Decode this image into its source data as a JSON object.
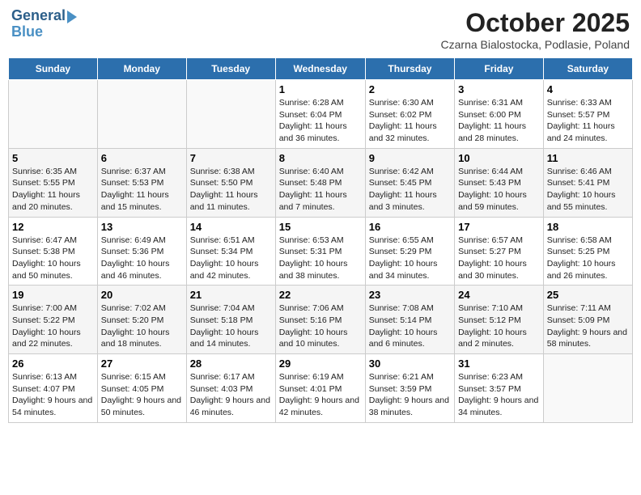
{
  "header": {
    "logo_line1": "General",
    "logo_line2": "Blue",
    "month": "October 2025",
    "location": "Czarna Bialostocka, Podlasie, Poland"
  },
  "weekdays": [
    "Sunday",
    "Monday",
    "Tuesday",
    "Wednesday",
    "Thursday",
    "Friday",
    "Saturday"
  ],
  "weeks": [
    [
      {
        "day": "",
        "info": ""
      },
      {
        "day": "",
        "info": ""
      },
      {
        "day": "",
        "info": ""
      },
      {
        "day": "1",
        "info": "Sunrise: 6:28 AM\nSunset: 6:04 PM\nDaylight: 11 hours and 36 minutes."
      },
      {
        "day": "2",
        "info": "Sunrise: 6:30 AM\nSunset: 6:02 PM\nDaylight: 11 hours and 32 minutes."
      },
      {
        "day": "3",
        "info": "Sunrise: 6:31 AM\nSunset: 6:00 PM\nDaylight: 11 hours and 28 minutes."
      },
      {
        "day": "4",
        "info": "Sunrise: 6:33 AM\nSunset: 5:57 PM\nDaylight: 11 hours and 24 minutes."
      }
    ],
    [
      {
        "day": "5",
        "info": "Sunrise: 6:35 AM\nSunset: 5:55 PM\nDaylight: 11 hours and 20 minutes."
      },
      {
        "day": "6",
        "info": "Sunrise: 6:37 AM\nSunset: 5:53 PM\nDaylight: 11 hours and 15 minutes."
      },
      {
        "day": "7",
        "info": "Sunrise: 6:38 AM\nSunset: 5:50 PM\nDaylight: 11 hours and 11 minutes."
      },
      {
        "day": "8",
        "info": "Sunrise: 6:40 AM\nSunset: 5:48 PM\nDaylight: 11 hours and 7 minutes."
      },
      {
        "day": "9",
        "info": "Sunrise: 6:42 AM\nSunset: 5:45 PM\nDaylight: 11 hours and 3 minutes."
      },
      {
        "day": "10",
        "info": "Sunrise: 6:44 AM\nSunset: 5:43 PM\nDaylight: 10 hours and 59 minutes."
      },
      {
        "day": "11",
        "info": "Sunrise: 6:46 AM\nSunset: 5:41 PM\nDaylight: 10 hours and 55 minutes."
      }
    ],
    [
      {
        "day": "12",
        "info": "Sunrise: 6:47 AM\nSunset: 5:38 PM\nDaylight: 10 hours and 50 minutes."
      },
      {
        "day": "13",
        "info": "Sunrise: 6:49 AM\nSunset: 5:36 PM\nDaylight: 10 hours and 46 minutes."
      },
      {
        "day": "14",
        "info": "Sunrise: 6:51 AM\nSunset: 5:34 PM\nDaylight: 10 hours and 42 minutes."
      },
      {
        "day": "15",
        "info": "Sunrise: 6:53 AM\nSunset: 5:31 PM\nDaylight: 10 hours and 38 minutes."
      },
      {
        "day": "16",
        "info": "Sunrise: 6:55 AM\nSunset: 5:29 PM\nDaylight: 10 hours and 34 minutes."
      },
      {
        "day": "17",
        "info": "Sunrise: 6:57 AM\nSunset: 5:27 PM\nDaylight: 10 hours and 30 minutes."
      },
      {
        "day": "18",
        "info": "Sunrise: 6:58 AM\nSunset: 5:25 PM\nDaylight: 10 hours and 26 minutes."
      }
    ],
    [
      {
        "day": "19",
        "info": "Sunrise: 7:00 AM\nSunset: 5:22 PM\nDaylight: 10 hours and 22 minutes."
      },
      {
        "day": "20",
        "info": "Sunrise: 7:02 AM\nSunset: 5:20 PM\nDaylight: 10 hours and 18 minutes."
      },
      {
        "day": "21",
        "info": "Sunrise: 7:04 AM\nSunset: 5:18 PM\nDaylight: 10 hours and 14 minutes."
      },
      {
        "day": "22",
        "info": "Sunrise: 7:06 AM\nSunset: 5:16 PM\nDaylight: 10 hours and 10 minutes."
      },
      {
        "day": "23",
        "info": "Sunrise: 7:08 AM\nSunset: 5:14 PM\nDaylight: 10 hours and 6 minutes."
      },
      {
        "day": "24",
        "info": "Sunrise: 7:10 AM\nSunset: 5:12 PM\nDaylight: 10 hours and 2 minutes."
      },
      {
        "day": "25",
        "info": "Sunrise: 7:11 AM\nSunset: 5:09 PM\nDaylight: 9 hours and 58 minutes."
      }
    ],
    [
      {
        "day": "26",
        "info": "Sunrise: 6:13 AM\nSunset: 4:07 PM\nDaylight: 9 hours and 54 minutes."
      },
      {
        "day": "27",
        "info": "Sunrise: 6:15 AM\nSunset: 4:05 PM\nDaylight: 9 hours and 50 minutes."
      },
      {
        "day": "28",
        "info": "Sunrise: 6:17 AM\nSunset: 4:03 PM\nDaylight: 9 hours and 46 minutes."
      },
      {
        "day": "29",
        "info": "Sunrise: 6:19 AM\nSunset: 4:01 PM\nDaylight: 9 hours and 42 minutes."
      },
      {
        "day": "30",
        "info": "Sunrise: 6:21 AM\nSunset: 3:59 PM\nDaylight: 9 hours and 38 minutes."
      },
      {
        "day": "31",
        "info": "Sunrise: 6:23 AM\nSunset: 3:57 PM\nDaylight: 9 hours and 34 minutes."
      },
      {
        "day": "",
        "info": ""
      }
    ]
  ]
}
